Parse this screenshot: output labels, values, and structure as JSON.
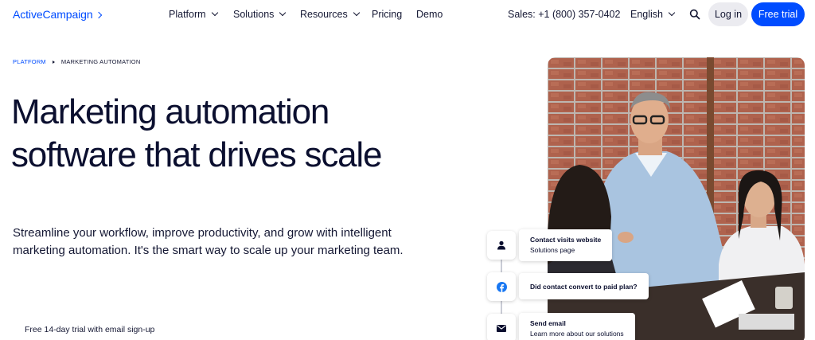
{
  "nav": {
    "logo": "ActiveCampaign",
    "items": [
      {
        "label": "Platform",
        "dropdown": true
      },
      {
        "label": "Solutions",
        "dropdown": true
      },
      {
        "label": "Resources",
        "dropdown": true
      },
      {
        "label": "Pricing",
        "dropdown": false
      },
      {
        "label": "Demo",
        "dropdown": false
      }
    ],
    "sales": "Sales: +1 (800) 357-0402",
    "language": "English",
    "login": "Log in",
    "cta": "Free trial"
  },
  "breadcrumb": {
    "parent": "PLATFORM",
    "current": "MARKETING AUTOMATION"
  },
  "hero": {
    "title": "Marketing automation software that drives scale",
    "subtitle": "Streamline your workflow, improve productivity, and grow with intelligent marketing automation. It's the smart way to scale up your marketing team.",
    "trial_note": "Free 14-day trial with email sign-up"
  },
  "workflow": [
    {
      "title": "Contact visits website",
      "subtitle": "Solutions page",
      "icon": "person-icon"
    },
    {
      "title": "Did contact convert to paid plan?",
      "subtitle": "",
      "icon": "facebook-icon"
    },
    {
      "title": "Send email",
      "subtitle": "Learn more about our solutions",
      "icon": "email-icon"
    }
  ],
  "colors": {
    "brand": "#004cff",
    "text": "#0b0f2f",
    "login_bg": "#ebebf0"
  }
}
